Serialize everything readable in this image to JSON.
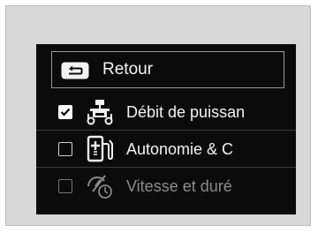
{
  "menu": {
    "back": {
      "icon": "back-arrow-icon",
      "label": "Retour"
    },
    "items": [
      {
        "label": "Débit de puissan",
        "checked": true,
        "icon": "power-flow-icon"
      },
      {
        "label": "Autonomie & C",
        "checked": false,
        "icon": "fuel-pump-range-icon"
      },
      {
        "label": "Vitesse et duré",
        "checked": false,
        "icon": "speed-time-icon"
      }
    ]
  }
}
